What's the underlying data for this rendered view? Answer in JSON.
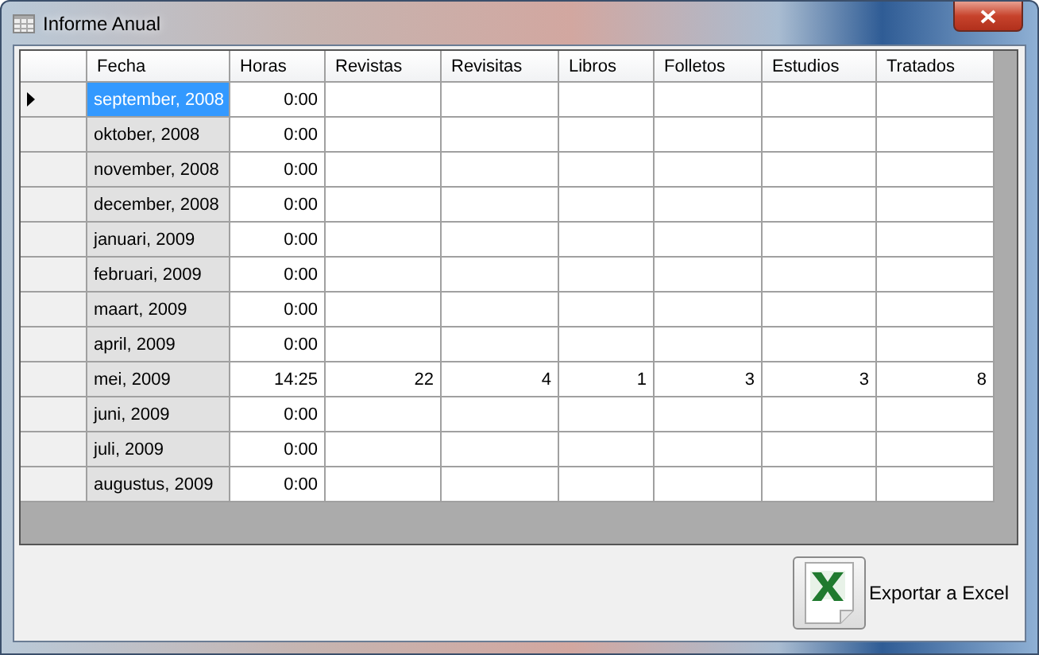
{
  "window": {
    "title": "Informe Anual"
  },
  "table": {
    "columns": [
      "Fecha",
      "Horas",
      "Revistas",
      "Revisitas",
      "Libros",
      "Folletos",
      "Estudios",
      "Tratados"
    ],
    "rows": [
      {
        "cells": [
          "september, 2008",
          "0:00"
        ],
        "selected": true,
        "current": true
      },
      {
        "cells": [
          "oktober, 2008",
          "0:00"
        ],
        "selected": false,
        "current": false
      },
      {
        "cells": [
          "november, 2008",
          "0:00"
        ],
        "selected": false,
        "current": false
      },
      {
        "cells": [
          "december, 2008",
          "0:00"
        ],
        "selected": false,
        "current": false
      },
      {
        "cells": [
          "januari, 2009",
          "0:00"
        ],
        "selected": false,
        "current": false
      },
      {
        "cells": [
          "februari, 2009",
          "0:00"
        ],
        "selected": false,
        "current": false
      },
      {
        "cells": [
          "maart, 2009",
          "0:00"
        ],
        "selected": false,
        "current": false
      },
      {
        "cells": [
          "april, 2009",
          "0:00"
        ],
        "selected": false,
        "current": false
      },
      {
        "cells": [
          "mei, 2009",
          "14:25",
          "22",
          "4",
          "1",
          "3",
          "3",
          "8"
        ],
        "selected": false,
        "current": false
      },
      {
        "cells": [
          "juni, 2009",
          "0:00"
        ],
        "selected": false,
        "current": false
      },
      {
        "cells": [
          "juli, 2009",
          "0:00"
        ],
        "selected": false,
        "current": false
      },
      {
        "cells": [
          "augustus, 2009",
          "0:00"
        ],
        "selected": false,
        "current": false
      }
    ]
  },
  "export_button": {
    "label": "Exportar a Excel"
  }
}
